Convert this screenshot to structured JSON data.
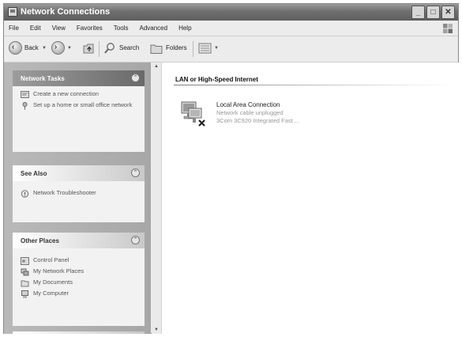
{
  "window": {
    "title": "Network Connections"
  },
  "menu": [
    "File",
    "Edit",
    "View",
    "Favorites",
    "Tools",
    "Advanced",
    "Help"
  ],
  "toolbar": {
    "back": "Back",
    "search": "Search",
    "folders": "Folders"
  },
  "sidebar": {
    "network_tasks": {
      "title": "Network Tasks",
      "items": [
        {
          "label": "Create a new connection",
          "icon": "new-connection-icon"
        },
        {
          "label": "Set up a home or small office network",
          "icon": "home-network-icon"
        }
      ]
    },
    "see_also": {
      "title": "See Also",
      "items": [
        {
          "label": "Network Troubleshooter",
          "icon": "troubleshooter-icon"
        }
      ]
    },
    "other_places": {
      "title": "Other Places",
      "items": [
        {
          "label": "Control Panel",
          "icon": "control-panel-icon"
        },
        {
          "label": "My Network Places",
          "icon": "network-places-icon"
        },
        {
          "label": "My Documents",
          "icon": "my-documents-icon"
        },
        {
          "label": "My Computer",
          "icon": "my-computer-icon"
        }
      ]
    }
  },
  "content": {
    "group_title": "LAN or High-Speed Internet",
    "connection": {
      "name": "Local Area Connection",
      "status": "Network cable unplugged",
      "device": "3Com 3C920 Integrated Fast ..."
    }
  }
}
